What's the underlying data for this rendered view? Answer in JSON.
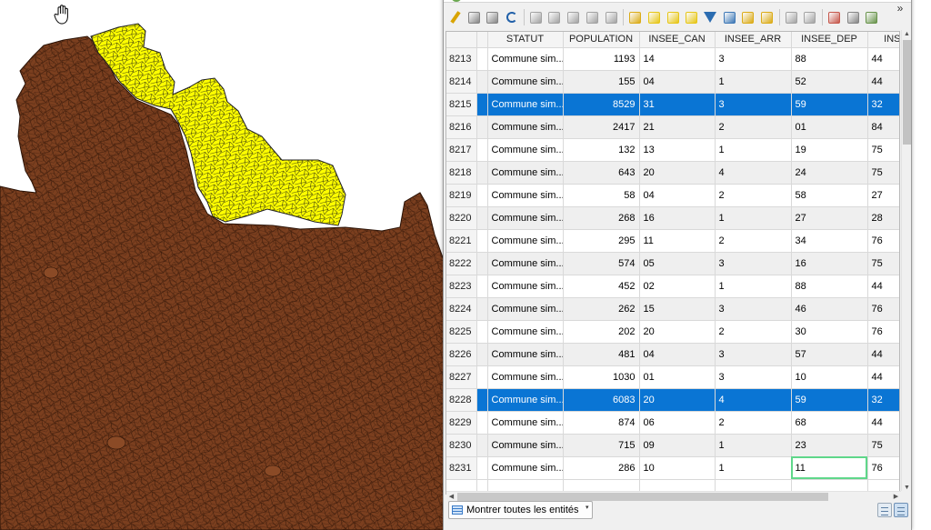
{
  "toolbar": {
    "buttons": [
      {
        "icon": "pencil-icon",
        "color": "#d9a400"
      },
      {
        "icon": "multi-edit-icon",
        "color": "#7a7a7a"
      },
      {
        "icon": "save-icon",
        "color": "#7a7a7a"
      },
      {
        "icon": "reload-icon",
        "color": "#1f5fa8"
      },
      {
        "icon": "add-feature-icon",
        "color": "#9a9a9a"
      },
      {
        "icon": "delete-feature-icon",
        "color": "#9a9a9a"
      },
      {
        "icon": "cut-icon",
        "color": "#9a9a9a"
      },
      {
        "icon": "copy-icon",
        "color": "#9a9a9a"
      },
      {
        "icon": "paste-icon",
        "color": "#9a9a9a"
      },
      {
        "icon": "select-expression-icon",
        "color": "#d9a400"
      },
      {
        "icon": "select-all-icon",
        "color": "#e6c200"
      },
      {
        "icon": "invert-selection-icon",
        "color": "#e6c200"
      },
      {
        "icon": "deselect-icon",
        "color": "#e6c200"
      },
      {
        "icon": "filter-icon",
        "color": "#2b6cb0"
      },
      {
        "icon": "move-selection-top-icon",
        "color": "#2b6cb0"
      },
      {
        "icon": "pan-to-selection-icon",
        "color": "#d9a400"
      },
      {
        "icon": "zoom-to-selection-icon",
        "color": "#d9a400"
      },
      {
        "icon": "copy-rows-icon",
        "color": "#9a9a9a"
      },
      {
        "icon": "paste-rows-icon",
        "color": "#9a9a9a"
      },
      {
        "icon": "new-field-icon",
        "color": "#c2483b"
      },
      {
        "icon": "delete-field-icon",
        "color": "#7a7a7a"
      },
      {
        "icon": "field-calculator-icon",
        "color": "#5a8a3a"
      }
    ],
    "more_label": "»"
  },
  "table": {
    "columns": [
      "STATUT",
      "POPULATION",
      "INSEE_CAN",
      "INSEE_ARR",
      "INSEE_DEP",
      "INSE"
    ],
    "rows": [
      {
        "id": "8213",
        "statut": "Commune sim...",
        "population": "1193",
        "insee_can": "14",
        "insee_arr": "3",
        "insee_dep": "88",
        "insee_reg": "44",
        "selected": false
      },
      {
        "id": "8214",
        "statut": "Commune sim...",
        "population": "155",
        "insee_can": "04",
        "insee_arr": "1",
        "insee_dep": "52",
        "insee_reg": "44",
        "selected": false
      },
      {
        "id": "8215",
        "statut": "Commune sim...",
        "population": "8529",
        "insee_can": "31",
        "insee_arr": "3",
        "insee_dep": "59",
        "insee_reg": "32",
        "selected": true
      },
      {
        "id": "8216",
        "statut": "Commune sim...",
        "population": "2417",
        "insee_can": "21",
        "insee_arr": "2",
        "insee_dep": "01",
        "insee_reg": "84",
        "selected": false
      },
      {
        "id": "8217",
        "statut": "Commune sim...",
        "population": "132",
        "insee_can": "13",
        "insee_arr": "1",
        "insee_dep": "19",
        "insee_reg": "75",
        "selected": false
      },
      {
        "id": "8218",
        "statut": "Commune sim...",
        "population": "643",
        "insee_can": "20",
        "insee_arr": "4",
        "insee_dep": "24",
        "insee_reg": "75",
        "selected": false
      },
      {
        "id": "8219",
        "statut": "Commune sim...",
        "population": "58",
        "insee_can": "04",
        "insee_arr": "2",
        "insee_dep": "58",
        "insee_reg": "27",
        "selected": false
      },
      {
        "id": "8220",
        "statut": "Commune sim...",
        "population": "268",
        "insee_can": "16",
        "insee_arr": "1",
        "insee_dep": "27",
        "insee_reg": "28",
        "selected": false
      },
      {
        "id": "8221",
        "statut": "Commune sim...",
        "population": "295",
        "insee_can": "11",
        "insee_arr": "2",
        "insee_dep": "34",
        "insee_reg": "76",
        "selected": false
      },
      {
        "id": "8222",
        "statut": "Commune sim...",
        "population": "574",
        "insee_can": "05",
        "insee_arr": "3",
        "insee_dep": "16",
        "insee_reg": "75",
        "selected": false
      },
      {
        "id": "8223",
        "statut": "Commune sim...",
        "population": "452",
        "insee_can": "02",
        "insee_arr": "1",
        "insee_dep": "88",
        "insee_reg": "44",
        "selected": false
      },
      {
        "id": "8224",
        "statut": "Commune sim...",
        "population": "262",
        "insee_can": "15",
        "insee_arr": "3",
        "insee_dep": "46",
        "insee_reg": "76",
        "selected": false
      },
      {
        "id": "8225",
        "statut": "Commune sim...",
        "population": "202",
        "insee_can": "20",
        "insee_arr": "2",
        "insee_dep": "30",
        "insee_reg": "76",
        "selected": false
      },
      {
        "id": "8226",
        "statut": "Commune sim...",
        "population": "481",
        "insee_can": "04",
        "insee_arr": "3",
        "insee_dep": "57",
        "insee_reg": "44",
        "selected": false
      },
      {
        "id": "8227",
        "statut": "Commune sim...",
        "population": "1030",
        "insee_can": "01",
        "insee_arr": "3",
        "insee_dep": "10",
        "insee_reg": "44",
        "selected": false
      },
      {
        "id": "8228",
        "statut": "Commune sim...",
        "population": "6083",
        "insee_can": "20",
        "insee_arr": "4",
        "insee_dep": "59",
        "insee_reg": "32",
        "selected": true
      },
      {
        "id": "8229",
        "statut": "Commune sim...",
        "population": "874",
        "insee_can": "06",
        "insee_arr": "2",
        "insee_dep": "68",
        "insee_reg": "44",
        "selected": false
      },
      {
        "id": "8230",
        "statut": "Commune sim...",
        "population": "715",
        "insee_can": "09",
        "insee_arr": "1",
        "insee_dep": "23",
        "insee_reg": "75",
        "selected": false
      },
      {
        "id": "8231",
        "statut": "Commune sim...",
        "population": "286",
        "insee_can": "10",
        "insee_arr": "1",
        "insee_dep": "11",
        "insee_reg": "76",
        "selected": false,
        "focus_col": "insee_dep"
      }
    ]
  },
  "bottom": {
    "show_all_label": "Montrer toutes les entités",
    "caret": "▾"
  },
  "map": {
    "base_color": "#7b3f1f",
    "selected_color": "#ffff00",
    "boundary_color": "#3a1a0a",
    "pan_tool_icon": "hand-pan-icon"
  }
}
